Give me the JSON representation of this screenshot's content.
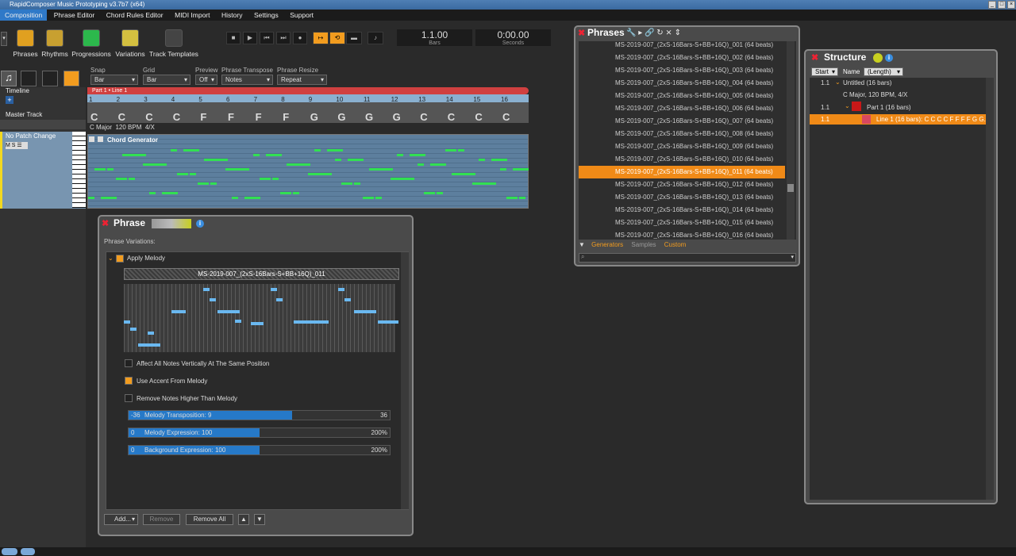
{
  "app": {
    "title": "RapidComposer Music Prototyping v3.7b7 (x64)"
  },
  "menu": [
    "Composition",
    "Phrase Editor",
    "Chord Rules Editor",
    "MIDI Import",
    "History",
    "Settings",
    "Support"
  ],
  "toolbar": {
    "buttons": [
      "Phrases",
      "Rhythms",
      "Progressions",
      "Variations",
      "Track Templates"
    ],
    "position": "1.1.00",
    "position_label": "Bars",
    "time": "0:00.00",
    "time_label": "Seconds"
  },
  "controls": {
    "snap_label": "Snap",
    "snap": "Bar",
    "grid_label": "Grid",
    "grid": "Bar",
    "preview_label": "Preview",
    "preview": "Off",
    "transpose_label": "Phrase Transpose",
    "transpose": "Notes",
    "resize_label": "Phrase Resize",
    "resize": "Repeat"
  },
  "tracks": {
    "timeline": "Timeline",
    "master": "Master Track",
    "patch": "No Patch Change",
    "key_info": "C Major",
    "tempo": "120 BPM",
    "meter": "4/X",
    "generator": "Chord Generator",
    "part_label": "Part 1 • Line 1",
    "ruler": [
      "1",
      "2",
      "3",
      "4",
      "5",
      "6",
      "7",
      "8",
      "9",
      "10",
      "11",
      "12",
      "13",
      "14",
      "15",
      "16"
    ],
    "chords": [
      "C",
      "C",
      "C",
      "C",
      "F",
      "F",
      "F",
      "F",
      "G",
      "G",
      "G",
      "G",
      "C",
      "C",
      "C",
      "C"
    ]
  },
  "phrases": {
    "title": "Phrases",
    "items": [
      "MS-2019-007_(2xS-16Bars-S+BB+16Q)_001 (64 beats)",
      "MS-2019-007_(2xS-16Bars-S+BB+16Q)_002 (64 beats)",
      "MS-2019-007_(2xS-16Bars-S+BB+16Q)_003 (64 beats)",
      "MS-2019-007_(2xS-16Bars-S+BB+16Q)_004 (64 beats)",
      "MS-2019-007_(2xS-16Bars-S+BB+16Q)_005 (64 beats)",
      "MS-2019-007_(2xS-16Bars-S+BB+16Q)_006 (64 beats)",
      "MS-2019-007_(2xS-16Bars-S+BB+16Q)_007 (64 beats)",
      "MS-2019-007_(2xS-16Bars-S+BB+16Q)_008 (64 beats)",
      "MS-2019-007_(2xS-16Bars-S+BB+16Q)_009 (64 beats)",
      "MS-2019-007_(2xS-16Bars-S+BB+16Q)_010 (64 beats)",
      "MS-2019-007_(2xS-16Bars-S+BB+16Q)_011 (64 beats)",
      "MS-2019-007_(2xS-16Bars-S+BB+16Q)_012 (64 beats)",
      "MS-2019-007_(2xS-16Bars-S+BB+16Q)_013 (64 beats)",
      "MS-2019-007_(2xS-16Bars-S+BB+16Q)_014 (64 beats)",
      "MS-2019-007_(2xS-16Bars-S+BB+16Q)_015 (64 beats)",
      "MS-2019-007_(2xS-16Bars-S+BB+16Q)_016 (64 beats)"
    ],
    "selected_index": 10,
    "tabs": [
      "Generators",
      "Samples",
      "Custom"
    ]
  },
  "structure": {
    "title": "Structure",
    "col_start": "Start",
    "col_name": "Name",
    "col_length": "(Length)",
    "rows": [
      {
        "start": "1.1",
        "text": "Untitled (16 bars)"
      },
      {
        "start": "",
        "text": "C Major, 120 BPM, 4/X"
      },
      {
        "start": "1.1",
        "text": "Part 1 (16 bars)"
      },
      {
        "start": "1.1",
        "text": "Line 1 (16 bars): C C C C F F F F G G."
      }
    ]
  },
  "phrase_panel": {
    "title": "Phrase",
    "variations_label": "Phrase Variations:",
    "apply_melody": "Apply Melody",
    "phrase_name": "MS-2019-007_(2xS-16Bars-S+BB+16Q)_011",
    "opt1": "Affect All Notes Vertically At The Same Position",
    "opt2": "Use Accent From Melody",
    "opt3": "Remove Notes Higher Than Melody",
    "s1_min": "-36",
    "s1_label": "Melody Transposition: 9",
    "s1_max": "36",
    "s1_value": 0.625,
    "s2_min": "0",
    "s2_label": "Melody Expression: 100",
    "s2_max": "200%",
    "s2_value": 0.5,
    "s3_min": "0",
    "s3_label": "Background Expression: 100",
    "s3_max": "200%",
    "s3_value": 0.5,
    "add": "Add...",
    "remove": "Remove",
    "remove_all": "Remove All"
  }
}
